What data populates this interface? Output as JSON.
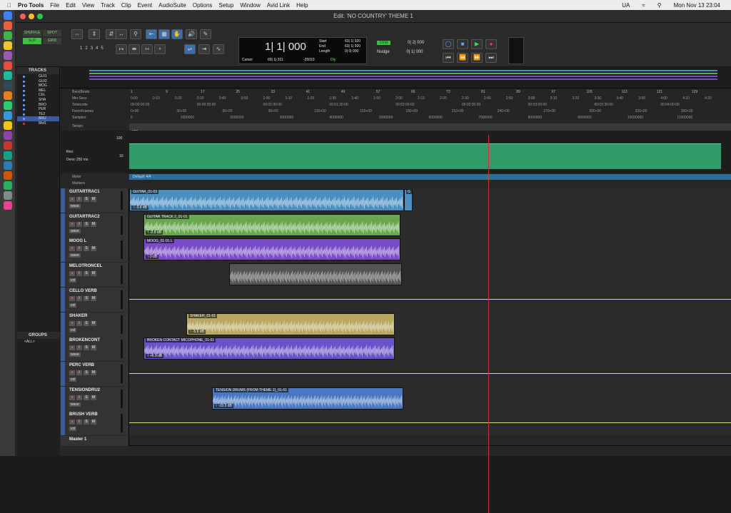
{
  "menubar": {
    "app": "Pro Tools",
    "items": [
      "File",
      "Edit",
      "View",
      "Track",
      "Clip",
      "Event",
      "AudioSuite",
      "Options",
      "Setup",
      "Window",
      "Avid Link",
      "Help"
    ],
    "status_ua": "UA",
    "clock": "Mon Nov 13  23:04"
  },
  "window": {
    "title": "Edit: 'NO COUNTRY' THEME 1"
  },
  "modes": {
    "shuffle": "SHUFFLE",
    "spot": "SPOT",
    "slip": "SLIP",
    "grid": "GRID"
  },
  "zoom_presets": [
    "1",
    "2",
    "3",
    "4",
    "5"
  ],
  "counter": {
    "main": "1| 1| 000",
    "start_label": "Start",
    "end_label": "End",
    "length_label": "Length",
    "start": "63| 1| 920",
    "end": "63| 1| 920",
    "length": "0| 0| 000",
    "cursor_label": "Cursor",
    "cursor": "69| 1| 311",
    "cursor_samples": "-35010",
    "dly": "Dly"
  },
  "grid": {
    "label": "Grid",
    "value": "0| 2| 000",
    "nudge_label": "Nudge",
    "nudge": "0| 1| 000"
  },
  "tracks_panel": {
    "title": "TRACKS",
    "items": [
      "GUI1",
      "GUI2",
      "MOG",
      "MEL",
      "CEL",
      "SHA",
      "BRO",
      "PER",
      "TE2",
      "BRU",
      "Mst1"
    ]
  },
  "groups_panel": {
    "title": "GROUPS",
    "all": "<ALL>"
  },
  "rulers": {
    "bars_label": "Bars|Beats",
    "minsecs_label": "Min:Secs",
    "timecode_label": "Timecode",
    "feet_label": "Feet+Frames",
    "samples_label": "Samples",
    "tempo_label": "Tempo",
    "meter_label": "Meter",
    "markers_label": "Markers",
    "bars": [
      "1",
      "9",
      "17",
      "25",
      "33",
      "41",
      "49",
      "57",
      "65",
      "73",
      "81",
      "89",
      "97",
      "105",
      "113",
      "121",
      "129"
    ],
    "minsecs": [
      "0:00",
      "0:10",
      "0:20",
      "0:30",
      "0:40",
      "0:50",
      "1:00",
      "1:10",
      "1:20",
      "1:30",
      "1:40",
      "1:50",
      "2:00",
      "2:10",
      "2:20",
      "2:30",
      "2:40",
      "2:50",
      "3:00",
      "3:10",
      "3:20",
      "3:30",
      "3:40",
      "3:50",
      "4:00",
      "4:10",
      "4:20"
    ],
    "timecode": [
      "00:00:00:00",
      "00:00:30:00",
      "00:01:00:00",
      "00:01:30:00",
      "00:02:00:00",
      "00:02:30:00",
      "00:03:00:00",
      "00:03:30:00",
      "00:04:00:00"
    ],
    "feet": [
      "0+00",
      "30+00",
      "60+00",
      "90+00",
      "120+00",
      "150+00",
      "180+00",
      "210+00",
      "240+00",
      "270+00",
      "300+00",
      "330+00",
      "360+00"
    ],
    "samples": [
      "0",
      "1000000",
      "2000000",
      "3000000",
      "4000000",
      "5000000",
      "6000000",
      "7000000",
      "8000000",
      "9000000",
      "10000000",
      "11000000"
    ],
    "tempo_value": "126",
    "meter_value": "Default: 4/4"
  },
  "tempo_editor": {
    "top_value": "100",
    "bottom_value": "10",
    "res_label": "Res:",
    "dens_label": "Dens:",
    "dens_value": "250 ms"
  },
  "tracks": [
    {
      "name": "GUITARTRAC1",
      "view": "wave",
      "clip": "GUITAR_01-03",
      "gain": "-3.8 dB",
      "color": "#4a8fc0"
    },
    {
      "name": "GUITARTRAC2",
      "view": "wave",
      "clip": "GUITAR TRACK 2_01-01",
      "gain": "-2.8 dB",
      "color": "#6aa84f"
    },
    {
      "name": "MOOG L",
      "view": "wave",
      "clip": "MOOG_01-01 L",
      "gain": "0 dB",
      "color": "#7a4cc8"
    },
    {
      "name": "MELOTRONCEL",
      "view": "vol",
      "clip": "",
      "gain": "",
      "color": "#555"
    },
    {
      "name": "CELLO VERB",
      "view": "vol",
      "clip": "",
      "gain": "",
      "color": ""
    },
    {
      "name": "SHAKER",
      "view": "vol",
      "clip": "SHAKER_01-01",
      "gain": "-5.6 dB",
      "color": "#b8a860"
    },
    {
      "name": "BROKENCONT",
      "view": "wave",
      "clip": "BROKEN CONTACT MICOPHONE_01-01",
      "gain": "+6.9 dB",
      "color": "#6a52c8"
    },
    {
      "name": "PERC VERB",
      "view": "vol",
      "clip": "",
      "gain": "",
      "color": ""
    },
    {
      "name": "TENSIONDRU2",
      "view": "wave",
      "clip": "TENSION DRUMS (FROM THEME 2)_01-01",
      "gain": "-10.3 dB",
      "color": "#4a78c0"
    },
    {
      "name": "BRUSH VERB",
      "view": "vol",
      "clip": "",
      "gain": "",
      "color": ""
    }
  ],
  "master": "Master 1",
  "small_clip": "G",
  "track_buttons": {
    "rec": "●",
    "input": "I",
    "solo": "S",
    "mute": "M"
  }
}
